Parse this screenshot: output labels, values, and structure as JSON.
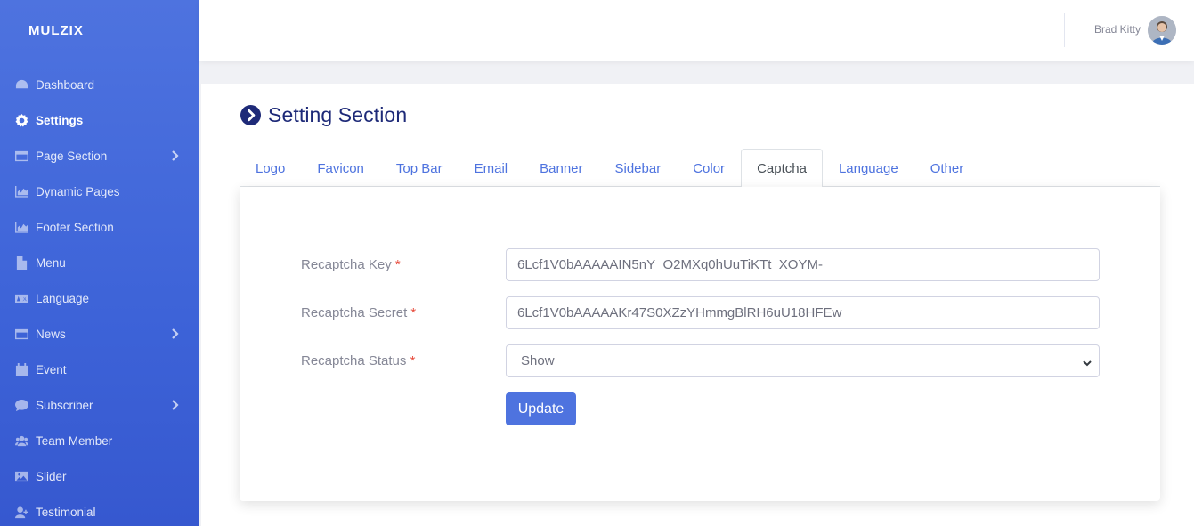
{
  "brand": "MULZIX",
  "sidebar": {
    "items": [
      {
        "label": "Dashboard",
        "icon": "dashboard-icon",
        "chevron": false,
        "active": false
      },
      {
        "label": "Settings",
        "icon": "gear-icon",
        "chevron": false,
        "active": true
      },
      {
        "label": "Page Section",
        "icon": "window-icon",
        "chevron": true,
        "active": false
      },
      {
        "label": "Dynamic Pages",
        "icon": "chart-icon",
        "chevron": false,
        "active": false
      },
      {
        "label": "Footer Section",
        "icon": "chart-icon",
        "chevron": false,
        "active": false
      },
      {
        "label": "Menu",
        "icon": "file-icon",
        "chevron": false,
        "active": false
      },
      {
        "label": "Language",
        "icon": "language-icon",
        "chevron": false,
        "active": false
      },
      {
        "label": "News",
        "icon": "window-icon",
        "chevron": true,
        "active": false
      },
      {
        "label": "Event",
        "icon": "calendar-icon",
        "chevron": false,
        "active": false
      },
      {
        "label": "Subscriber",
        "icon": "comment-icon",
        "chevron": true,
        "active": false
      },
      {
        "label": "Team Member",
        "icon": "users-icon",
        "chevron": false,
        "active": false
      },
      {
        "label": "Slider",
        "icon": "image-icon",
        "chevron": false,
        "active": false
      },
      {
        "label": "Testimonial",
        "icon": "user-plus-icon",
        "chevron": false,
        "active": false
      }
    ]
  },
  "topbar": {
    "user_name": "Brad Kitty",
    "avatar_icon": "user-avatar-icon"
  },
  "page": {
    "title": "Setting Section",
    "title_icon": "chevron-circle-right-icon"
  },
  "tabs": [
    {
      "label": "Logo",
      "active": false
    },
    {
      "label": "Favicon",
      "active": false
    },
    {
      "label": "Top Bar",
      "active": false
    },
    {
      "label": "Email",
      "active": false
    },
    {
      "label": "Banner",
      "active": false
    },
    {
      "label": "Sidebar",
      "active": false
    },
    {
      "label": "Color",
      "active": false
    },
    {
      "label": "Captcha",
      "active": true
    },
    {
      "label": "Language",
      "active": false
    },
    {
      "label": "Other",
      "active": false
    }
  ],
  "form": {
    "required_mark": "*",
    "recaptcha_key": {
      "label": "Recaptcha Key",
      "value": "6Lcf1V0bAAAAAIN5nY_O2MXq0hUuTiKTt_XOYM-_"
    },
    "recaptcha_secret": {
      "label": "Recaptcha Secret",
      "value": "6Lcf1V0bAAAAAKr47S0XZzYHmmgBlRH6uU18HFEw"
    },
    "recaptcha_status": {
      "label": "Recaptcha Status",
      "value": "Show"
    },
    "update_label": "Update"
  },
  "colors": {
    "primary": "#4e73df",
    "title": "#1e2a78",
    "required": "#e74a3b",
    "label": "#858796"
  }
}
